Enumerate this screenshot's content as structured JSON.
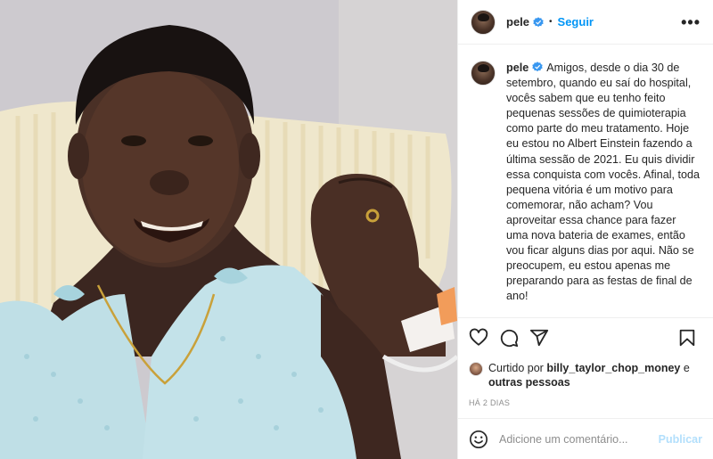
{
  "header": {
    "username": "pele",
    "dot": "•",
    "follow_label": "Seguir",
    "more_label": "•••"
  },
  "caption": {
    "username": "pele",
    "text": "Amigos, desde o dia 30 de setembro, quando eu saí do hospital, vocês sabem que eu tenho feito pequenas sessões de quimioterapia como parte do meu tratamento. Hoje eu estou no Albert Einstein fazendo a última sessão de 2021. Eu quis dividir essa conquista com vocês. Afinal, toda pequena vitória é um motivo para comemorar, não acham? Vou aproveitar essa chance para fazer uma nova bateria de exames, então vou ficar alguns dias por aqui. Não se preocupem, eu estou apenas me preparando para as festas de final de ano!\n\n//"
  },
  "likes": {
    "prefix": "Curtido por",
    "user": "billy_taylor_chop_money",
    "connector": "e",
    "others": "outras pessoas"
  },
  "timestamp": "HÁ 2 DIAS",
  "comment": {
    "placeholder": "Adicione um comentário...",
    "publish_label": "Publicar"
  },
  "icons": {
    "like": "heart-icon",
    "comment": "comment-icon",
    "share": "share-icon",
    "save": "bookmark-icon",
    "emoji": "emoji-icon",
    "verified": "verified-badge-icon"
  },
  "colors": {
    "accent": "#0095f6",
    "verified": "#3897f0",
    "publish_disabled": "#b2dffc"
  }
}
